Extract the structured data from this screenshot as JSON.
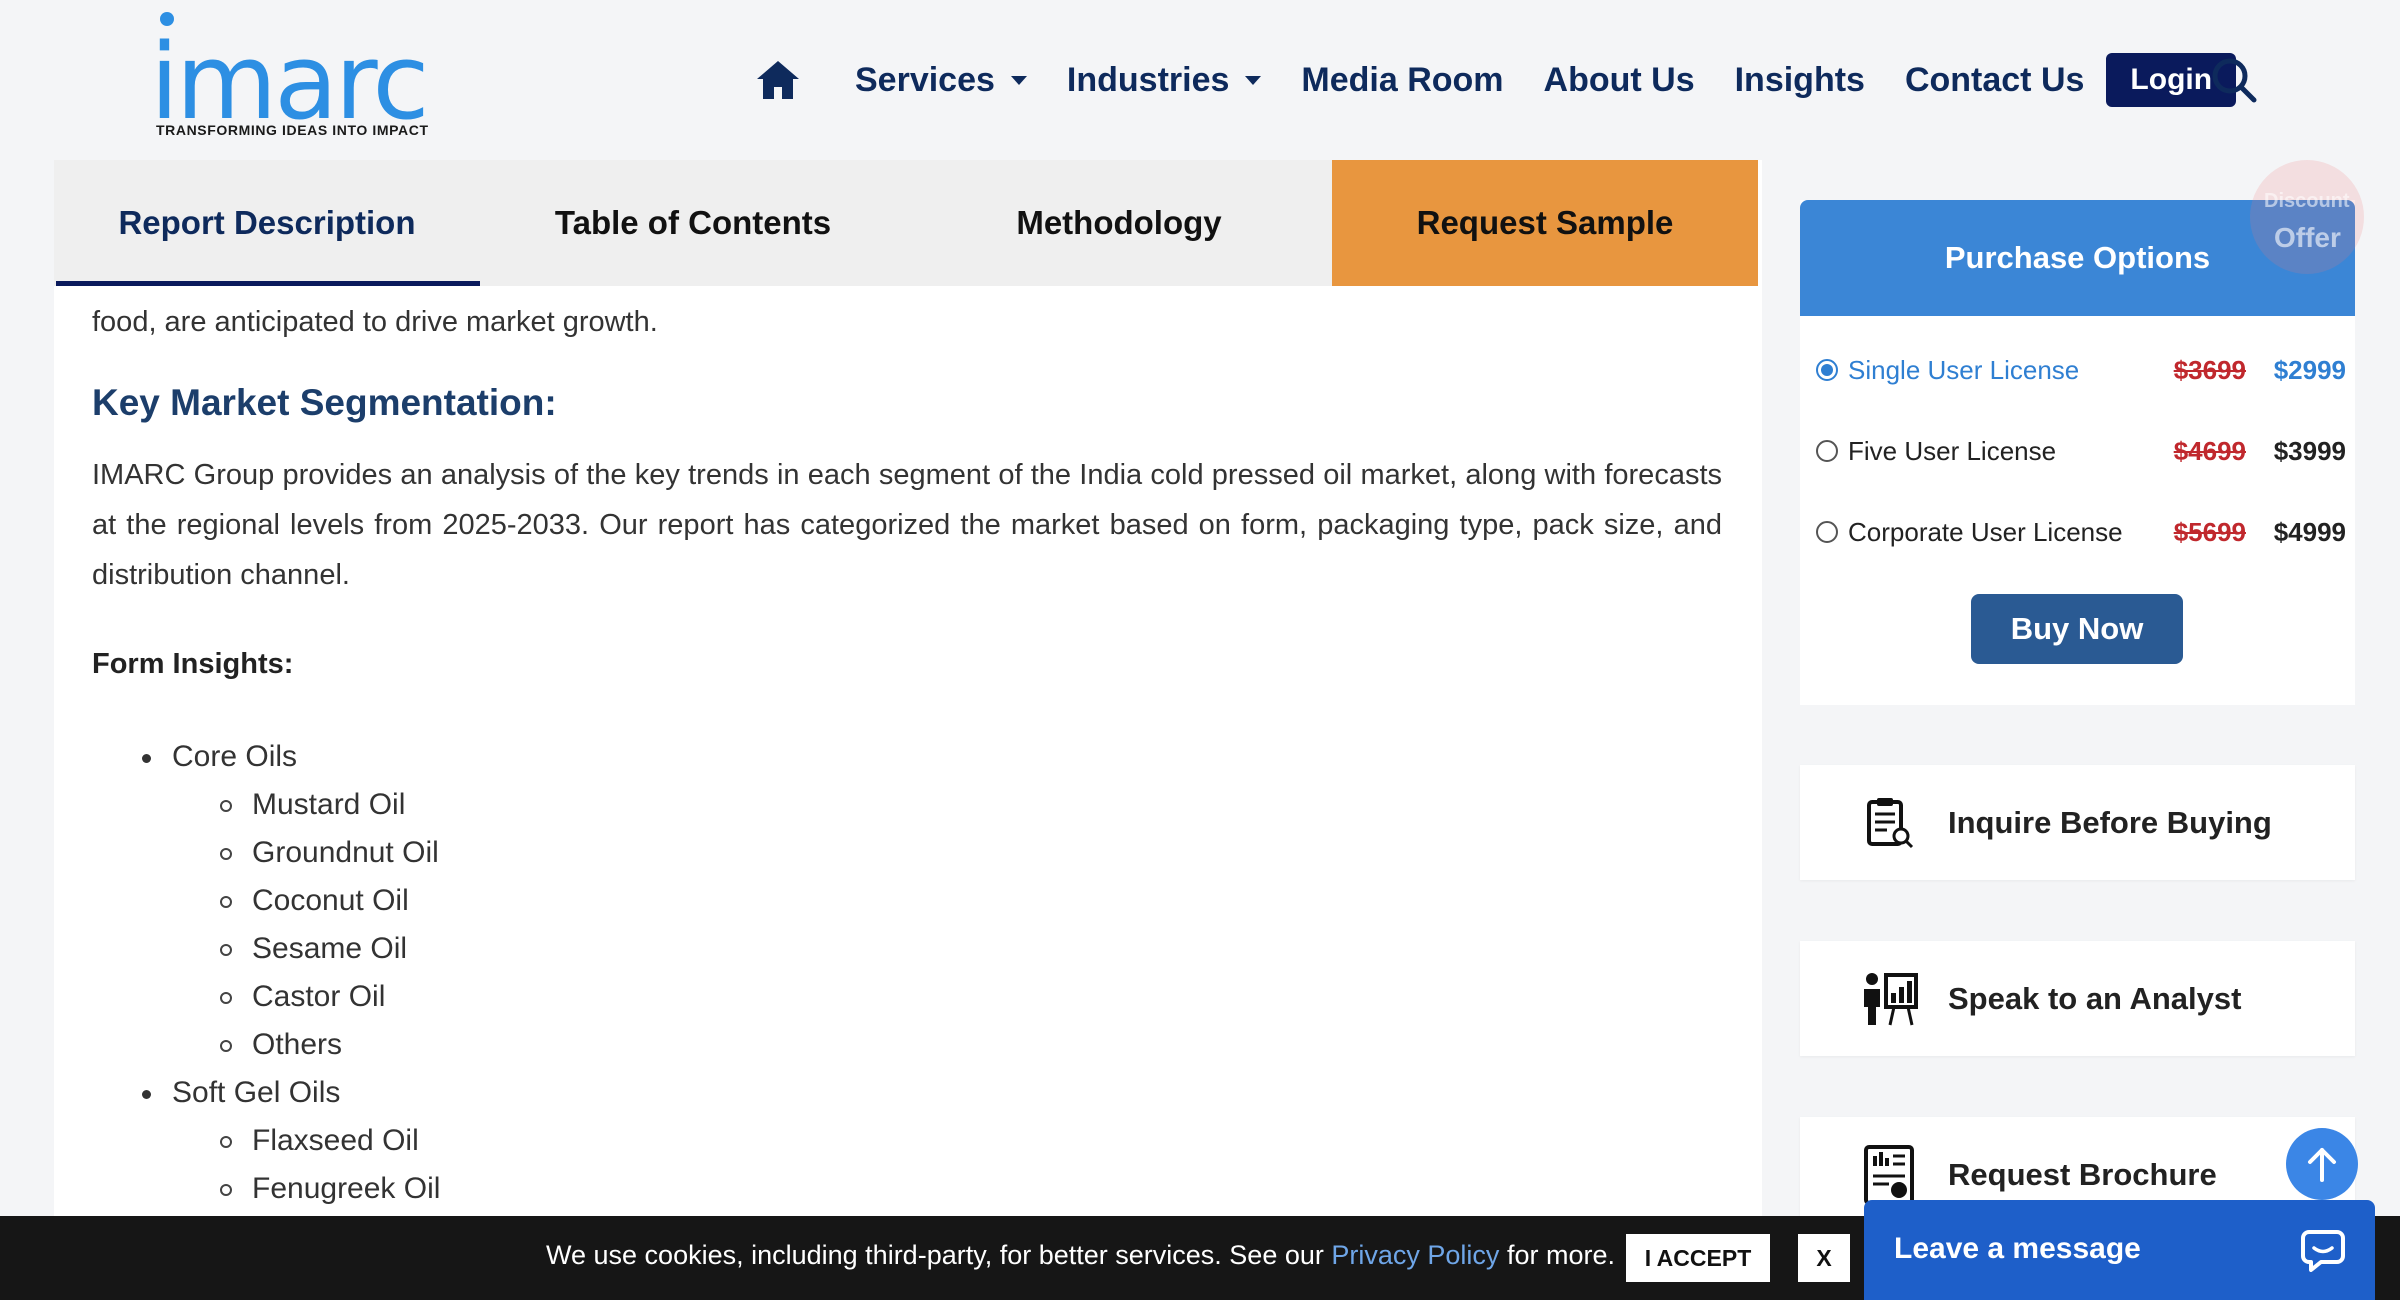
{
  "brand": {
    "name": "imarc",
    "tagline": "TRANSFORMING IDEAS INTO IMPACT",
    "color": "#2d8fe3"
  },
  "nav": {
    "home_icon": "home-icon",
    "items": [
      "Services",
      "Industries",
      "Media Room",
      "About Us",
      "Insights",
      "Contact Us"
    ],
    "login": "Login",
    "search_icon": "search-icon"
  },
  "tabs": [
    {
      "label": "Report Description",
      "active": true
    },
    {
      "label": "Table of Contents",
      "active": false
    },
    {
      "label": "Methodology",
      "active": false
    },
    {
      "label": "Request Sample",
      "active": false
    }
  ],
  "content": {
    "para_fragment": "food, are anticipated to drive market growth.",
    "segmentation_heading": "Key Market Segmentation:",
    "segmentation_text": "IMARC Group provides an analysis of the key trends in each segment of the India cold pressed oil market, along with forecasts at the regional levels from 2025-2033. Our report has categorized the market based on form, packaging type, pack size, and distribution channel.",
    "form_heading": "Form Insights:",
    "list": [
      {
        "label": "Core Oils",
        "children": [
          "Mustard Oil",
          "Groundnut Oil",
          "Coconut Oil",
          "Sesame Oil",
          "Castor Oil",
          "Others"
        ]
      },
      {
        "label": "Soft Gel Oils",
        "children": [
          "Flaxseed Oil",
          "Fenugreek Oil"
        ]
      }
    ]
  },
  "purchase": {
    "title": "Purchase Options",
    "options": [
      {
        "label": "Single User License",
        "old_price": "$3699",
        "new_price": "$2999",
        "selected": true
      },
      {
        "label": "Five User License",
        "old_price": "$4699",
        "new_price": "$3999",
        "selected": false
      },
      {
        "label": "Corporate User License",
        "old_price": "$5699",
        "new_price": "$4999",
        "selected": false
      }
    ],
    "buy_label": "Buy Now",
    "discount_line1": "Discount",
    "discount_line2": "Offer"
  },
  "side_links": [
    {
      "label": "Inquire Before Buying",
      "icon": "clipboard-search-icon"
    },
    {
      "label": "Speak to an Analyst",
      "icon": "analyst-presentation-icon"
    },
    {
      "label": "Request Brochure",
      "icon": "brochure-icon"
    }
  ],
  "cookie": {
    "text_before": "We use cookies, including third-party, for better services. See our",
    "link": "Privacy Policy",
    "text_after": "for more.",
    "accept": "I ACCEPT",
    "close": "X"
  },
  "chat": {
    "label": "Leave a message",
    "icon": "chat-bubble-icon"
  },
  "scroll_top_icon": "arrow-up-icon"
}
